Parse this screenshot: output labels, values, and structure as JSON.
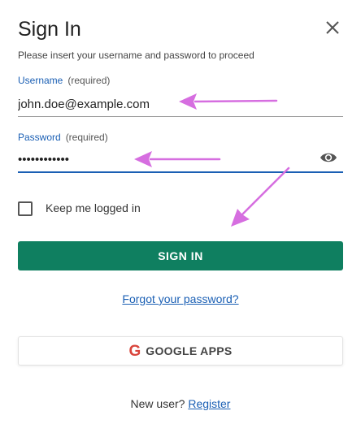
{
  "dialog": {
    "title": "Sign In",
    "subtitle": "Please insert your username and password to proceed"
  },
  "username": {
    "label": "Username",
    "required": "(required)",
    "value": "john.doe@example.com"
  },
  "password": {
    "label": "Password",
    "required": "(required)",
    "value": "••••••••••••"
  },
  "remember": {
    "label": "Keep me logged in",
    "checked": false
  },
  "buttons": {
    "sign_in": "SIGN IN",
    "forgot": "Forgot your password?",
    "google_letter": "G",
    "google": "GOOGLE APPS"
  },
  "footer": {
    "prompt": "New user?",
    "register": "Register"
  },
  "icons": {
    "close": "close-icon",
    "show_password": "eye-icon",
    "google": "google-g-icon"
  },
  "colors": {
    "primary_button": "#0f7f60",
    "link": "#1a5fb4",
    "annotation_arrow": "#d66ee0",
    "google_red": "#d9453c"
  }
}
